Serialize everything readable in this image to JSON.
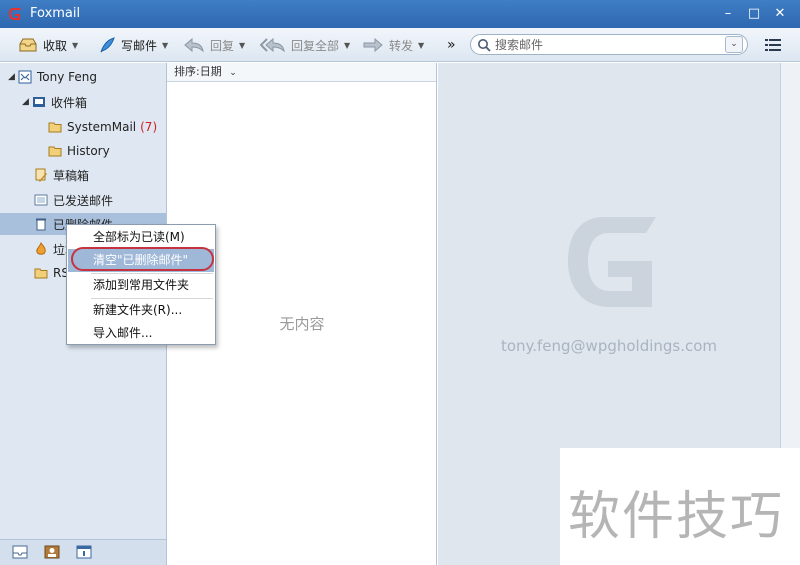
{
  "window": {
    "title": "Foxmail",
    "controls": [
      "–",
      "□",
      "✕"
    ]
  },
  "toolbar": {
    "receive": "收取",
    "compose": "写邮件",
    "reply": "回复",
    "reply_all": "回复全部",
    "forward": "转发",
    "more": "»",
    "search_placeholder": "搜索邮件"
  },
  "sidebar": {
    "account": "Tony Feng",
    "inbox": "收件箱",
    "subfolders": [
      {
        "label": "SystemMail",
        "count": "(7)"
      },
      {
        "label": "History"
      }
    ],
    "drafts": "草稿箱",
    "sent": "已发送邮件",
    "deleted": "已删除邮件",
    "junk": "垃圾邮件",
    "rss": "RSS"
  },
  "context_menu": {
    "items": [
      "全部标为已读(M)",
      "清空\"已删除邮件\"",
      "添加到常用文件夹",
      "新建文件夹(R)...",
      "导入邮件..."
    ]
  },
  "mail_list": {
    "sort_label": "排序:日期",
    "empty_text": "无内容"
  },
  "preview": {
    "email": "tony.feng@wpgholdings.com"
  },
  "watermark": {
    "text": "软件技巧"
  },
  "colors": {
    "titlebar": "#3370b8",
    "selection": "#a9c0dc",
    "highlight_ring": "#c5343e",
    "unread_count": "#d02020"
  }
}
